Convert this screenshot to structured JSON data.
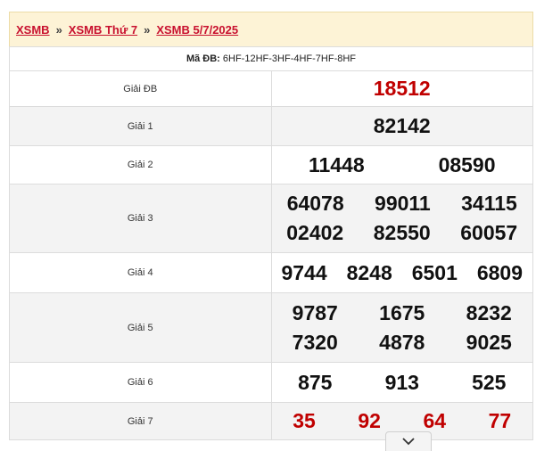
{
  "breadcrumb": {
    "items": [
      "XSMB",
      "XSMB Thứ 7",
      "XSMB 5/7/2025"
    ],
    "separator": "»"
  },
  "header": {
    "code_label": "Mã ĐB:",
    "code_value": "6HF-12HF-3HF-4HF-7HF-8HF"
  },
  "prizes": {
    "db": {
      "label": "Giải ĐB",
      "numbers": [
        "18512"
      ]
    },
    "g1": {
      "label": "Giải 1",
      "numbers": [
        "82142"
      ]
    },
    "g2": {
      "label": "Giải 2",
      "numbers": [
        "11448",
        "08590"
      ]
    },
    "g3": {
      "label": "Giải 3",
      "numbers": [
        "64078",
        "99011",
        "34115",
        "02402",
        "82550",
        "60057"
      ]
    },
    "g4": {
      "label": "Giải 4",
      "numbers": [
        "9744",
        "8248",
        "6501",
        "6809"
      ]
    },
    "g5": {
      "label": "Giải 5",
      "numbers": [
        "9787",
        "1675",
        "8232",
        "7320",
        "4878",
        "9025"
      ]
    },
    "g6": {
      "label": "Giải 6",
      "numbers": [
        "875",
        "913",
        "525"
      ]
    },
    "g7": {
      "label": "Giải 7",
      "numbers": [
        "35",
        "92",
        "64",
        "77"
      ]
    }
  },
  "scroll_button": {
    "icon": "chevron-down-icon"
  },
  "colors": {
    "accent_red": "#c00000",
    "header_bg": "#fdf3d6"
  }
}
